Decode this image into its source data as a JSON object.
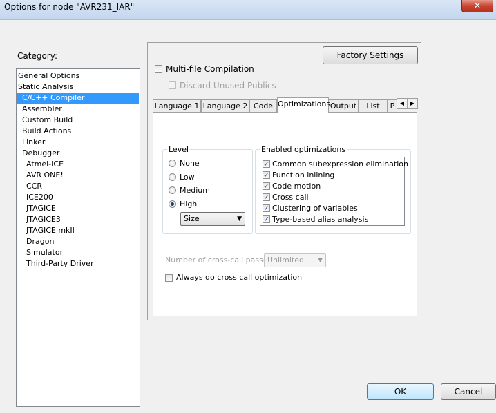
{
  "window": {
    "title": "Options for node \"AVR231_IAR\"",
    "close_glyph": "✕"
  },
  "category": {
    "label": "Category:",
    "items": [
      {
        "label": "General Options",
        "indent": 0
      },
      {
        "label": "Static Analysis",
        "indent": 0
      },
      {
        "label": "C/C++ Compiler",
        "indent": 1,
        "selected": true
      },
      {
        "label": "Assembler",
        "indent": 1
      },
      {
        "label": "Custom Build",
        "indent": 1
      },
      {
        "label": "Build Actions",
        "indent": 1
      },
      {
        "label": "Linker",
        "indent": 1
      },
      {
        "label": "Debugger",
        "indent": 1
      },
      {
        "label": "Atmel-ICE",
        "indent": 2
      },
      {
        "label": "AVR ONE!",
        "indent": 2
      },
      {
        "label": "CCR",
        "indent": 2
      },
      {
        "label": "ICE200",
        "indent": 2
      },
      {
        "label": "JTAGICE",
        "indent": 2
      },
      {
        "label": "JTAGICE3",
        "indent": 2
      },
      {
        "label": "JTAGICE mkII",
        "indent": 2
      },
      {
        "label": "Dragon",
        "indent": 2
      },
      {
        "label": "Simulator",
        "indent": 2
      },
      {
        "label": "Third-Party Driver",
        "indent": 2
      }
    ]
  },
  "panel": {
    "factory_settings": "Factory Settings",
    "multi_file": {
      "label": "Multi-file Compilation",
      "checked": false
    },
    "discard_unused": {
      "label": "Discard Unused Publics",
      "checked": false,
      "disabled": true
    }
  },
  "tabs": [
    {
      "label": "Language 1"
    },
    {
      "label": "Language 2"
    },
    {
      "label": "Code"
    },
    {
      "label": "Optimizations",
      "active": true
    },
    {
      "label": "Output"
    },
    {
      "label": "List"
    },
    {
      "label": "P"
    }
  ],
  "tab_scroll": {
    "left": "◀",
    "right": "▶"
  },
  "level": {
    "legend": "Level",
    "options": [
      {
        "label": "None",
        "selected": false
      },
      {
        "label": "Low",
        "selected": false
      },
      {
        "label": "Medium",
        "selected": false
      },
      {
        "label": "High",
        "selected": true
      }
    ],
    "goal": {
      "value": "Size",
      "arrow": "▼"
    }
  },
  "enabled_optimizations": {
    "legend": "Enabled optimizations",
    "items": [
      {
        "label": "Common subexpression elimination",
        "checked": true
      },
      {
        "label": "Function inlining",
        "checked": true
      },
      {
        "label": "Code motion",
        "checked": true
      },
      {
        "label": "Cross call",
        "checked": true
      },
      {
        "label": "Clustering of variables",
        "checked": true
      },
      {
        "label": "Type-based alias analysis",
        "checked": true
      }
    ]
  },
  "cross_call": {
    "label": "Number of cross-call passes:",
    "value": "Unlimited",
    "arrow": "▼",
    "always": {
      "label": "Always do cross call optimization",
      "checked": false
    }
  },
  "buttons": {
    "ok": "OK",
    "cancel": "Cancel"
  },
  "colors": {
    "selection": "#3399ff",
    "check": "#2a4e9a"
  }
}
